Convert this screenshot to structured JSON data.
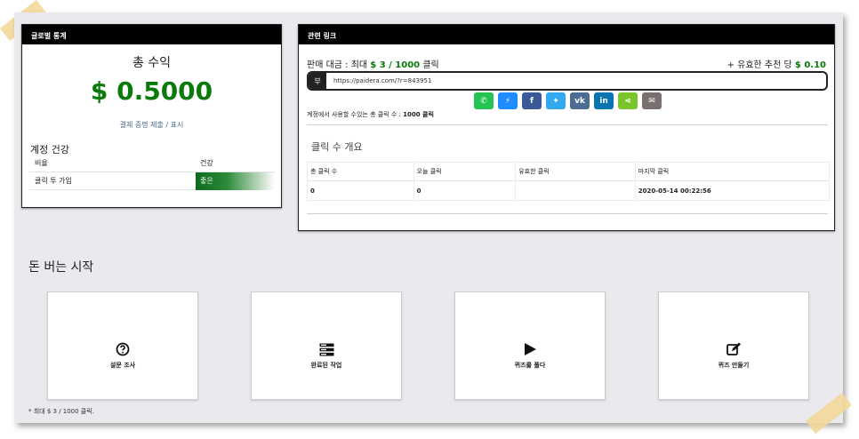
{
  "global_stats": {
    "header": "글로벌 통계",
    "total_label": "총 수익",
    "total_value": "$ 0.5000",
    "proof_link": "결제 증명 제출 / 표시",
    "health_title": "계정 건강",
    "health_columns": [
      "비율",
      "건강"
    ],
    "health_row": {
      "ratio": "클릭 투 가입",
      "status": "좋은"
    }
  },
  "links": {
    "header": "관련 링크",
    "sale_prefix": "판매 대금 : 최대 ",
    "sale_value": "$ 3 / 1000",
    "sale_suffix": " 클릭",
    "per_prefix": "+ 유효한 추천 당 ",
    "per_value": "$ 0.10",
    "url_prefix": "부",
    "url": "https://paidera.com/?r=843951",
    "share_buttons": [
      {
        "name": "whatsapp-icon",
        "glyph": "✆",
        "color": "#25c351"
      },
      {
        "name": "messenger-icon",
        "glyph": "⚡",
        "color": "#1f8cff"
      },
      {
        "name": "facebook-icon",
        "glyph": "f",
        "color": "#3b5998"
      },
      {
        "name": "twitter-icon",
        "glyph": "✦",
        "color": "#33aaf0"
      },
      {
        "name": "vk-icon",
        "glyph": "vk",
        "color": "#4c6c91"
      },
      {
        "name": "linkedin-icon",
        "glyph": "in",
        "color": "#0a74b0"
      },
      {
        "name": "share-icon",
        "glyph": "⋖",
        "color": "#7ac62a"
      },
      {
        "name": "email-icon",
        "glyph": "✉",
        "color": "#7a6e6e"
      }
    ],
    "clicks_available_prefix": "계정에서 사용할 수있는 총 클릭 수 : ",
    "clicks_available_value": "1000 클릭",
    "overview_title": "클릭 수 개요",
    "table_headers": [
      "총 클릭 수",
      "오늘 클릭",
      "유효한 클릭",
      "마지막 클릭"
    ],
    "table_row": [
      "0",
      "0",
      "",
      "2020-05-14 00:22:56"
    ]
  },
  "start": {
    "title": "돈 버는 시작",
    "cards": [
      {
        "label": "설문 조사",
        "icon": "question-circle-icon"
      },
      {
        "label": "완료된 작업",
        "icon": "server-list-icon"
      },
      {
        "label": "퀴즈를 풀다",
        "icon": "play-icon"
      },
      {
        "label": "퀴즈 만들기",
        "icon": "edit-icon"
      }
    ],
    "footnote": "* 최대 $ 3 / 1000 클릭."
  }
}
